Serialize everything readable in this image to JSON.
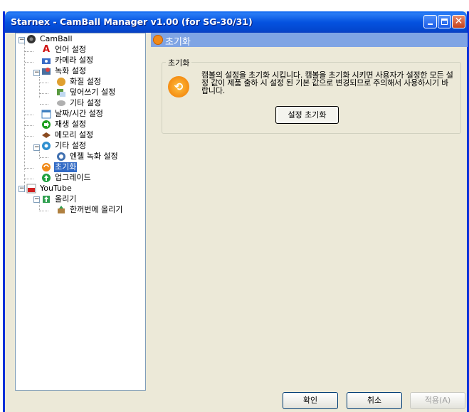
{
  "window": {
    "title": "Starnex - CamBall Manager v1.00 (for SG-30/31)"
  },
  "tree": {
    "items": [
      {
        "label": "CamBall",
        "icon": "camera-ball-icon",
        "color": "#333333"
      },
      {
        "label": "언어 설정",
        "icon": "language-icon",
        "color": "#d01010"
      },
      {
        "label": "카메라 설정",
        "icon": "camera-icon",
        "color": "#3a6cc8"
      },
      {
        "label": "녹화 설정",
        "icon": "record-icon",
        "color": "#4a70a0"
      },
      {
        "label": "화질 설정",
        "icon": "quality-icon",
        "color": "#e0a030"
      },
      {
        "label": "덮어쓰기 설정",
        "icon": "overwrite-icon",
        "color": "#5a9a40"
      },
      {
        "label": "기타 설정",
        "icon": "etc-icon",
        "color": "#909090"
      },
      {
        "label": "날짜/시간 설정",
        "icon": "calendar-icon",
        "color": "#4080c0"
      },
      {
        "label": "재생 설정",
        "icon": "play-icon",
        "color": "#20a020"
      },
      {
        "label": "메모리 설정",
        "icon": "memory-icon",
        "color": "#8a4a20"
      },
      {
        "label": "기타 설정",
        "icon": "settings-icon",
        "color": "#3090d0"
      },
      {
        "label": "엔젤 녹화 설정",
        "icon": "angel-record-icon",
        "color": "#4070b0"
      },
      {
        "label": "초기화",
        "icon": "reset-icon",
        "color": "#f08a1a"
      },
      {
        "label": "업그레이드",
        "icon": "upgrade-icon",
        "color": "#20a040"
      },
      {
        "label": "YouTube",
        "icon": "youtube-icon",
        "color": "#d02020"
      },
      {
        "label": "올리기",
        "icon": "upload-icon",
        "color": "#30a050"
      },
      {
        "label": "한꺼번에 올리기",
        "icon": "batch-upload-icon",
        "color": "#b08040"
      }
    ]
  },
  "panel": {
    "header": "초기화",
    "group_title": "초기화",
    "description": "캠볼의 설정을 초기화 시킵니다. 캠볼을 초기화 시키면 사용자가 설정한 모든 설정 값이 제품 출하 시 설정 된 기본 값으로 변경되므로 주의해서 사용하시기 바랍니다.",
    "reset_button": "설정 초기화"
  },
  "buttons": {
    "ok": "확인",
    "cancel": "취소",
    "apply": "적용(A)"
  }
}
